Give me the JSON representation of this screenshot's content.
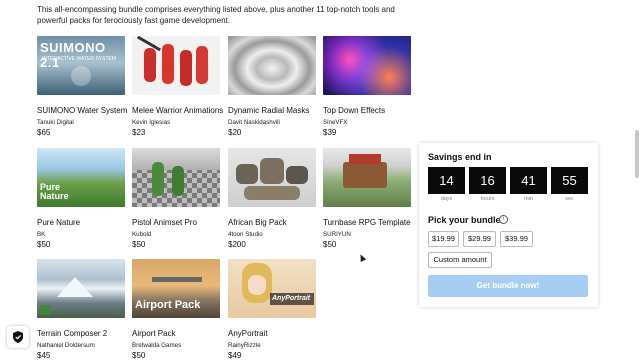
{
  "intro": "This all-encompassing bundle comprises everything listed above, plus another 11 top-notch tools and powerful packs for ferociously fast game development.",
  "products": [
    {
      "title": "SUIMONO Water System",
      "publisher": "Tanuki Digital",
      "price": "$65",
      "thumb_text": "SUIMONO 2.1",
      "thumb_sub": "INTERACTIVE WATER SYSTEM"
    },
    {
      "title": "Melee Warrior Animations",
      "publisher": "Kevin Iglesias",
      "price": "$23"
    },
    {
      "title": "Dynamic Radial Masks",
      "publisher": "Davit Naskidashvili",
      "price": "$20"
    },
    {
      "title": "Top Down Effects",
      "publisher": "SineVFX",
      "price": "$39"
    },
    {
      "title": "Pure Nature",
      "publisher": "BK",
      "price": "$50",
      "thumb_text": "Pure Nature"
    },
    {
      "title": "Pistol Animset Pro",
      "publisher": "Kubold",
      "price": "$50"
    },
    {
      "title": "African Big Pack",
      "publisher": "4toon Studio",
      "price": "$200"
    },
    {
      "title": "Turnbase RPG Template",
      "publisher": "SURIYUN",
      "price": "$50"
    },
    {
      "title": "Terrain Composer 2",
      "publisher": "Nathaniel Doldersum",
      "price": "$45"
    },
    {
      "title": "Airport Pack",
      "publisher": "Bretwalda Games",
      "price": "$50",
      "thumb_text": "Airport Pack"
    },
    {
      "title": "AnyPortrait",
      "publisher": "RainyRizzle",
      "price": "$49",
      "thumb_text": "AnyPortrait"
    }
  ],
  "panel": {
    "savings_title": "Savings end in",
    "countdown": [
      {
        "value": "14",
        "label": "days"
      },
      {
        "value": "16",
        "label": "hours"
      },
      {
        "value": "41",
        "label": "min"
      },
      {
        "value": "55",
        "label": "sec"
      }
    ],
    "pick_title": "Pick your bundle",
    "info_icon": "i",
    "options": [
      "$19.99",
      "$29.99",
      "$39.99"
    ],
    "custom": "Custom amount",
    "cta": "Get bundle now!"
  },
  "colors": {
    "cta": "#a7cdf2",
    "timer_bg": "#0a0a0a"
  }
}
